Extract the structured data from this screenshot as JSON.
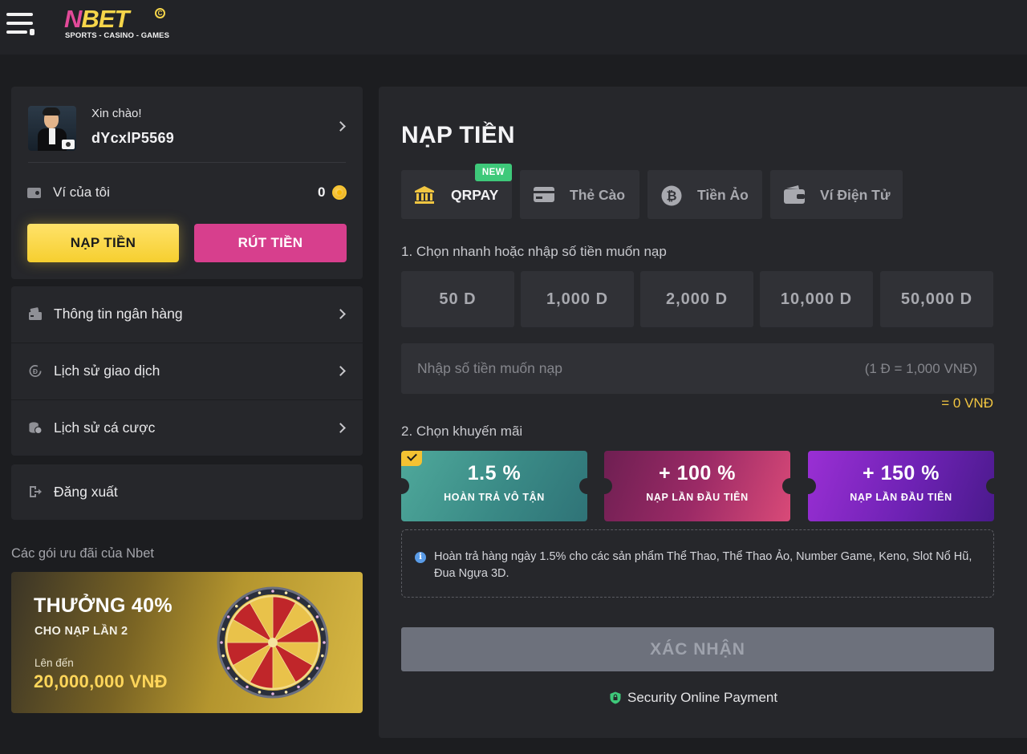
{
  "header": {
    "logo_n": "N",
    "logo_bet": "BET",
    "logo_reg": "C",
    "logo_tagline": "SPORTS - CASINO - GAMES"
  },
  "profile": {
    "greeting": "Xin chào!",
    "username": "dYcxlP5569",
    "wallet_label": "Ví của tôi",
    "wallet_amount": "0",
    "deposit_label": "NẠP TIỀN",
    "withdraw_label": "RÚT TIỀN"
  },
  "menu": {
    "items": [
      {
        "label": "Thông tin ngân hàng",
        "icon": "bank-card-icon"
      },
      {
        "label": "Lịch sử giao dịch",
        "icon": "history-icon"
      },
      {
        "label": "Lịch sử cá cược",
        "icon": "coins-icon"
      }
    ],
    "logout_label": "Đăng xuất"
  },
  "offers": {
    "section_title": "Các gói ưu đãi của Nbet",
    "banner_title": "THƯỞNG 40%",
    "banner_subtitle": "CHO NẠP LẦN 2",
    "banner_upto": "Lên đến",
    "banner_amount": "20,000,000 VNĐ"
  },
  "deposit": {
    "title": "NẠP TIỀN",
    "tabs": [
      {
        "label": "QRPAY",
        "icon": "bank-icon",
        "active": true,
        "badge": "NEW"
      },
      {
        "label": "Thẻ Cào",
        "icon": "card-icon",
        "active": false
      },
      {
        "label": "Tiền Ảo",
        "icon": "bitcoin-icon",
        "active": false
      },
      {
        "label": "Ví Điện Tử",
        "icon": "wallet-icon",
        "active": false
      }
    ],
    "step1_label": "1. Chọn nhanh hoặc nhập số tiền muốn nạp",
    "amounts": [
      "50 D",
      "1,000 D",
      "2,000 D",
      "10,000 D",
      "50,000 D"
    ],
    "input_placeholder": "Nhập số tiền muốn nạp",
    "rate_hint": "(1 Đ = 1,000 VNĐ)",
    "total": "= 0 VNĐ",
    "step2_label": "2. Chọn khuyến mãi",
    "promotions": [
      {
        "value": "1.5 %",
        "desc": "HOÀN TRẢ VÔ TẬN",
        "selected": true
      },
      {
        "value": "+ 100 %",
        "desc": "NẠP LẦN ĐẦU TIÊN",
        "selected": false
      },
      {
        "value": "+ 150 %",
        "desc": "NẠP LẦN ĐẦU TIÊN",
        "selected": false
      }
    ],
    "info_text": "Hoàn trả hàng ngày 1.5% cho các sản phẩm Thể Thao, Thể Thao Ảo, Number Game, Keno, Slot Nổ Hũ, Đua Ngựa 3D.",
    "confirm_label": "XÁC NHẬN",
    "security_text": "Security Online Payment"
  },
  "colors": {
    "background": "#1c1d20",
    "panel": "#26272b",
    "accent_yellow": "#f6cf2f",
    "accent_pink": "#d73f8d",
    "badge_green": "#3ec97a"
  }
}
